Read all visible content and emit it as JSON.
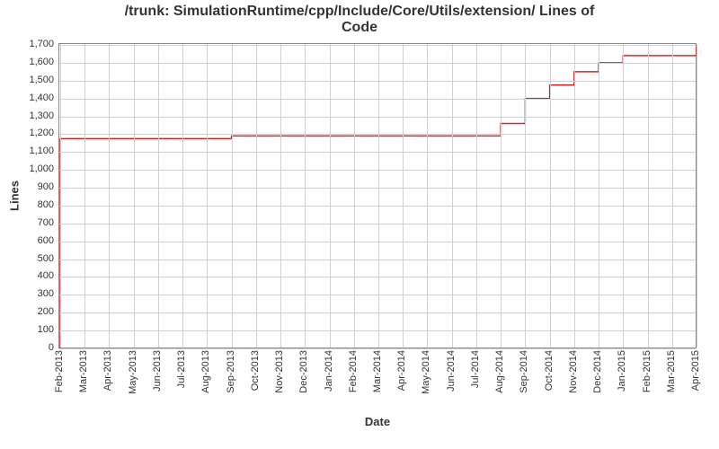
{
  "chart_data": {
    "type": "line",
    "title": "/trunk: SimulationRuntime/cpp/Include/Core/Utils/extension/ Lines of\nCode",
    "xlabel": "Date",
    "ylabel": "Lines",
    "ylim": [
      0,
      1700
    ],
    "y_ticks": [
      0,
      100,
      200,
      300,
      400,
      500,
      600,
      700,
      800,
      900,
      1000,
      1100,
      1200,
      1300,
      1400,
      1500,
      1600,
      1700
    ],
    "x_ticks": [
      "Feb-2013",
      "Mar-2013",
      "Apr-2013",
      "May-2013",
      "Jun-2013",
      "Jul-2013",
      "Aug-2013",
      "Sep-2013",
      "Oct-2013",
      "Nov-2013",
      "Dec-2013",
      "Jan-2014",
      "Feb-2014",
      "Mar-2014",
      "Apr-2014",
      "May-2014",
      "Jun-2014",
      "Jul-2014",
      "Aug-2014",
      "Sep-2014",
      "Oct-2014",
      "Nov-2014",
      "Dec-2014",
      "Jan-2015",
      "Feb-2015",
      "Mar-2015",
      "Apr-2015"
    ],
    "series": [
      {
        "name": "lines",
        "points": [
          {
            "x": "Feb-2013",
            "y": 0
          },
          {
            "x": "Feb-2013",
            "y": 1175
          },
          {
            "x": "Sep-2013",
            "y": 1175
          },
          {
            "x": "Sep-2013",
            "y": 1190
          },
          {
            "x": "Aug-2014",
            "y": 1190
          },
          {
            "x": "Aug-2014",
            "y": 1250
          },
          {
            "x": "Aug-2014",
            "y": 1260
          },
          {
            "x": "Sep-2014",
            "y": 1260
          },
          {
            "x": "Sep-2014",
            "y": 1375
          },
          {
            "x": "Sep-2014",
            "y": 1400
          },
          {
            "x": "Oct-2014",
            "y": 1400
          },
          {
            "x": "Oct-2014",
            "y": 1460
          },
          {
            "x": "Oct-2014",
            "y": 1475
          },
          {
            "x": "Nov-2014",
            "y": 1475
          },
          {
            "x": "Nov-2014",
            "y": 1550
          },
          {
            "x": "Dec-2014",
            "y": 1590
          },
          {
            "x": "Dec-2014",
            "y": 1600
          },
          {
            "x": "Jan-2015",
            "y": 1640
          },
          {
            "x": "Mar-2015",
            "y": 1640
          },
          {
            "x": "Apr-2015",
            "y": 1640
          },
          {
            "x": "Apr-2015",
            "y": 1690
          }
        ]
      }
    ]
  }
}
